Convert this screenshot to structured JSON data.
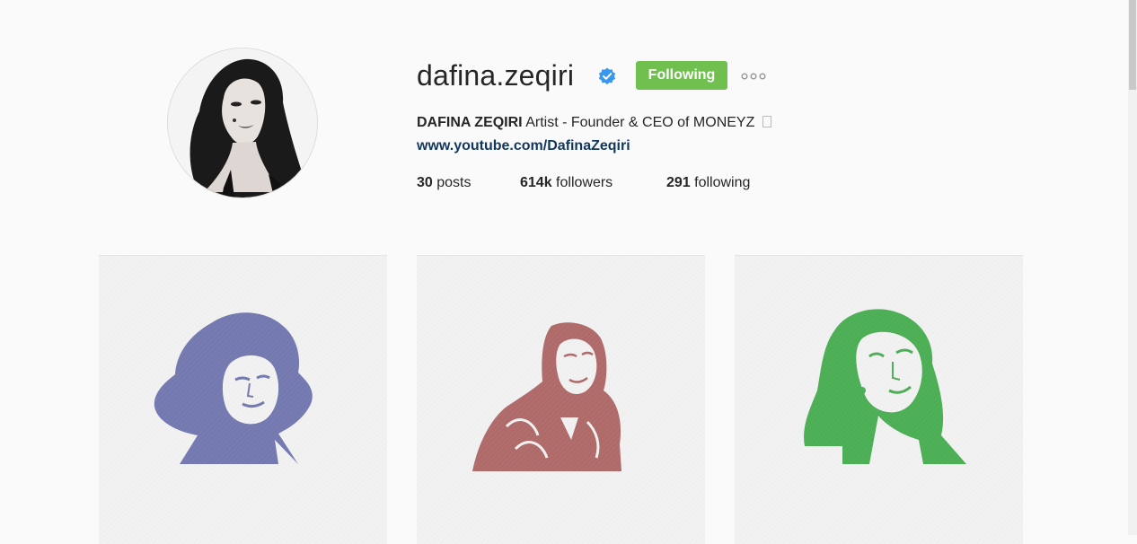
{
  "profile": {
    "username": "dafina.zeqiri",
    "verified_icon": "verified-badge-icon",
    "follow_button": "Following",
    "more_icon": "more-options-icon",
    "bio_name": "DAFINA ZEQIRI",
    "bio_text": " Artist - Founder & CEO of MONEYZ ",
    "website": "www.youtube.com/DafinaZeqiri",
    "stats": {
      "posts_count": "30",
      "posts_label": " posts",
      "followers_count": "614k",
      "followers_label": " followers",
      "following_count": "291",
      "following_label": " following"
    }
  },
  "colors": {
    "follow_button": "#70c050",
    "verified": "#3897f0",
    "link": "#12375c",
    "post1_tint": "#7479b0",
    "post2_tint": "#b06a6a",
    "post3_tint": "#4caf55"
  },
  "posts": [
    {
      "tint": "blue-violet",
      "subject": "portrait"
    },
    {
      "tint": "red",
      "subject": "portrait"
    },
    {
      "tint": "green",
      "subject": "portrait"
    }
  ]
}
